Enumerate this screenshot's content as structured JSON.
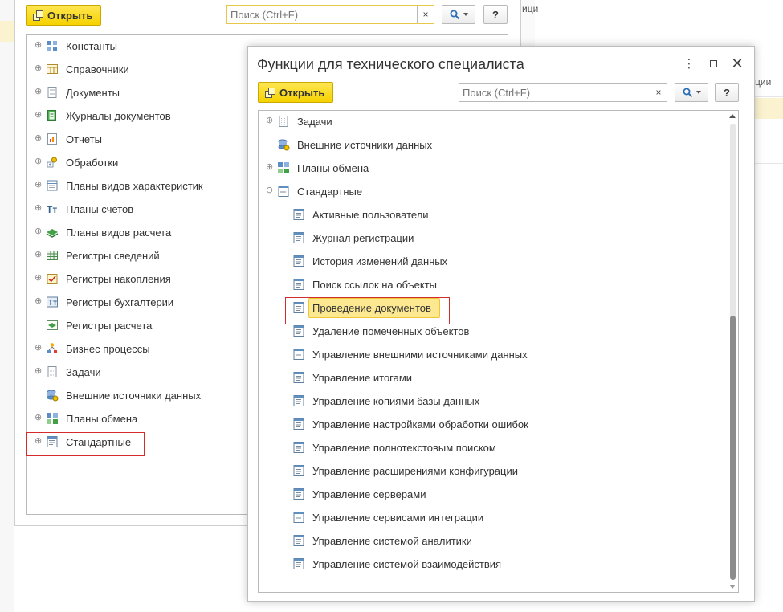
{
  "background": {
    "right_text": "ици",
    "right2_text": "ции"
  },
  "win1": {
    "open_label": "Открыть",
    "search_placeholder": "Поиск (Ctrl+F)",
    "clear_symbol": "×",
    "help_label": "?",
    "tree": [
      {
        "label": "Константы",
        "icon": "constants-icon",
        "expander": "plus"
      },
      {
        "label": "Справочники",
        "icon": "catalogs-icon",
        "expander": "plus"
      },
      {
        "label": "Документы",
        "icon": "documents-icon",
        "expander": "plus"
      },
      {
        "label": "Журналы документов",
        "icon": "document-journals-icon",
        "expander": "plus"
      },
      {
        "label": "Отчеты",
        "icon": "reports-icon",
        "expander": "plus"
      },
      {
        "label": "Обработки",
        "icon": "data-processors-icon",
        "expander": "plus"
      },
      {
        "label": "Планы видов характеристик",
        "icon": "chart-of-characteristic-types-icon",
        "expander": "plus"
      },
      {
        "label": "Планы счетов",
        "icon": "chart-of-accounts-icon",
        "expander": "plus"
      },
      {
        "label": "Планы видов расчета",
        "icon": "chart-of-calculation-types-icon",
        "expander": "plus"
      },
      {
        "label": "Регистры сведений",
        "icon": "information-registers-icon",
        "expander": "plus"
      },
      {
        "label": "Регистры накопления",
        "icon": "accumulation-registers-icon",
        "expander": "plus"
      },
      {
        "label": "Регистры бухгалтерии",
        "icon": "accounting-registers-icon",
        "expander": "plus"
      },
      {
        "label": "Регистры расчета",
        "icon": "calculation-registers-icon",
        "expander": "none"
      },
      {
        "label": "Бизнес процессы",
        "icon": "business-processes-icon",
        "expander": "plus"
      },
      {
        "label": "Задачи",
        "icon": "tasks-icon",
        "expander": "plus"
      },
      {
        "label": "Внешние источники данных",
        "icon": "external-data-sources-icon",
        "expander": "none"
      },
      {
        "label": "Планы обмена",
        "icon": "exchange-plans-icon",
        "expander": "plus"
      },
      {
        "label": "Стандартные",
        "icon": "standard-icon",
        "expander": "plus"
      }
    ]
  },
  "win2": {
    "title": "Функции для технического специалиста",
    "open_label": "Открыть",
    "search_placeholder": "Поиск (Ctrl+F)",
    "clear_symbol": "×",
    "help_label": "?",
    "scroll": {
      "thumb_start_fraction": 0.42,
      "thumb_size_fraction": 0.58
    },
    "tree": [
      {
        "label": "Задачи",
        "icon": "tasks-icon",
        "expander": "plus",
        "level": 0
      },
      {
        "label": "Внешние источники данных",
        "icon": "external-data-sources-icon",
        "expander": "none",
        "level": 0
      },
      {
        "label": "Планы обмена",
        "icon": "exchange-plans-icon",
        "expander": "plus",
        "level": 0
      },
      {
        "label": "Стандартные",
        "icon": "standard-icon",
        "expander": "minus",
        "level": 0
      },
      {
        "label": "Активные пользователи",
        "icon": "form-icon",
        "expander": "none",
        "level": 1
      },
      {
        "label": "Журнал регистрации",
        "icon": "form-icon",
        "expander": "none",
        "level": 1
      },
      {
        "label": "История изменений данных",
        "icon": "form-icon",
        "expander": "none",
        "level": 1
      },
      {
        "label": "Поиск ссылок на объекты",
        "icon": "form-icon",
        "expander": "none",
        "level": 1
      },
      {
        "label": "Проведение документов",
        "icon": "form-icon",
        "expander": "none",
        "level": 1,
        "selected": true
      },
      {
        "label": "Удаление помеченных объектов",
        "icon": "form-icon",
        "expander": "none",
        "level": 1
      },
      {
        "label": "Управление внешними источниками данных",
        "icon": "form-icon",
        "expander": "none",
        "level": 1
      },
      {
        "label": "Управление итогами",
        "icon": "form-icon",
        "expander": "none",
        "level": 1
      },
      {
        "label": "Управление копиями базы данных",
        "icon": "form-icon",
        "expander": "none",
        "level": 1
      },
      {
        "label": "Управление настройками обработки ошибок",
        "icon": "form-icon",
        "expander": "none",
        "level": 1
      },
      {
        "label": "Управление полнотекстовым поиском",
        "icon": "form-icon",
        "expander": "none",
        "level": 1
      },
      {
        "label": "Управление расширениями конфигурации",
        "icon": "form-icon",
        "expander": "none",
        "level": 1
      },
      {
        "label": "Управление серверами",
        "icon": "form-icon",
        "expander": "none",
        "level": 1
      },
      {
        "label": "Управление сервисами интеграции",
        "icon": "form-icon",
        "expander": "none",
        "level": 1
      },
      {
        "label": "Управление системой аналитики",
        "icon": "form-icon",
        "expander": "none",
        "level": 1
      },
      {
        "label": "Управление системой взаимодействия",
        "icon": "form-icon",
        "expander": "none",
        "level": 1
      }
    ]
  },
  "colors": {
    "accent_yellow": "#f5d200",
    "selection_fill": "#fde892",
    "highlight_red": "#d22c2c"
  }
}
